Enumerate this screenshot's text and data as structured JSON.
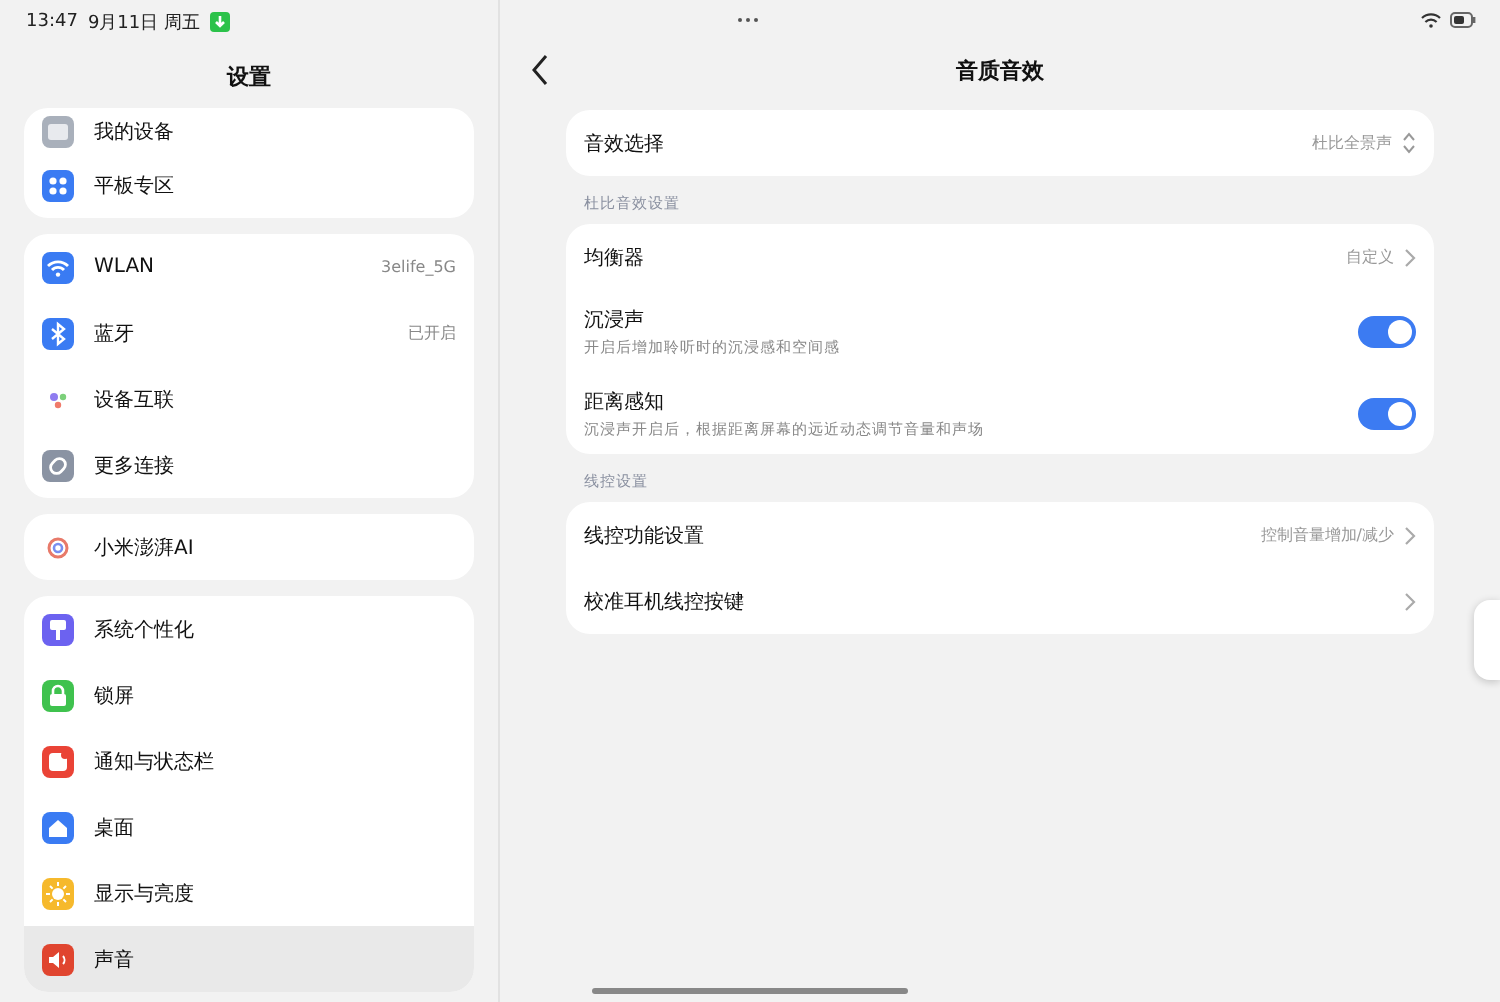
{
  "status_bar": {
    "time": "13:47",
    "date": "9月11日 周五"
  },
  "sidebar": {
    "title": "设置",
    "groups": [
      {
        "items": [
          {
            "label": "我的设备",
            "selected": false
          },
          {
            "label": "平板专区",
            "selected": false
          }
        ]
      },
      {
        "items": [
          {
            "label": "WLAN",
            "value": "3elife_5G",
            "selected": false
          },
          {
            "label": "蓝牙",
            "value": "已开启",
            "selected": false
          },
          {
            "label": "设备互联",
            "selected": false
          },
          {
            "label": "更多连接",
            "selected": false
          }
        ]
      },
      {
        "items": [
          {
            "label": "小米澎湃AI",
            "selected": false
          }
        ]
      },
      {
        "items": [
          {
            "label": "系统个性化",
            "selected": false
          },
          {
            "label": "锁屏",
            "selected": false
          },
          {
            "label": "通知与状态栏",
            "selected": false
          },
          {
            "label": "桌面",
            "selected": false
          },
          {
            "label": "显示与亮度",
            "selected": false
          },
          {
            "label": "声音",
            "selected": true
          }
        ]
      }
    ]
  },
  "page": {
    "title": "音质音效",
    "sections": [
      {
        "rows": [
          {
            "kind": "select",
            "label": "音效选择",
            "value": "杜比全景声"
          }
        ]
      },
      {
        "header": "杜比音效设置",
        "rows": [
          {
            "kind": "link",
            "label": "均衡器",
            "value": "自定义"
          },
          {
            "kind": "toggle",
            "label": "沉浸声",
            "description": "开启后增加聆听时的沉浸感和空间感",
            "on": true
          },
          {
            "kind": "toggle",
            "label": "距离感知",
            "description": "沉浸声开启后，根据距离屏幕的远近动态调节音量和声场",
            "on": true
          }
        ]
      },
      {
        "header": "线控设置",
        "rows": [
          {
            "kind": "link",
            "label": "线控功能设置",
            "value": "控制音量增加/减少"
          },
          {
            "kind": "link",
            "label": "校准耳机线控按键"
          }
        ]
      }
    ]
  }
}
